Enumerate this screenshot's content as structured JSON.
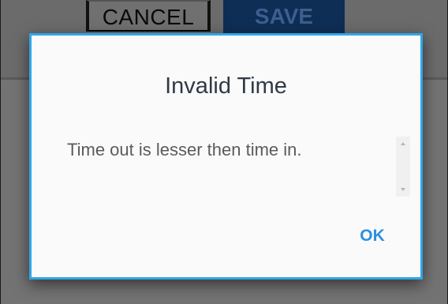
{
  "background": {
    "toolbar": {
      "cancel_label": "CANCEL",
      "save_label": "SAVE"
    }
  },
  "dialog": {
    "title": "Invalid Time",
    "message": "Time out is lesser then time in.",
    "ok_label": "OK",
    "accent_color": "#2fa6e8",
    "button_color": "#2b8fe0"
  },
  "icons": {
    "scroll_up": "scroll-up-arrow-icon",
    "scroll_down": "scroll-down-arrow-icon"
  }
}
